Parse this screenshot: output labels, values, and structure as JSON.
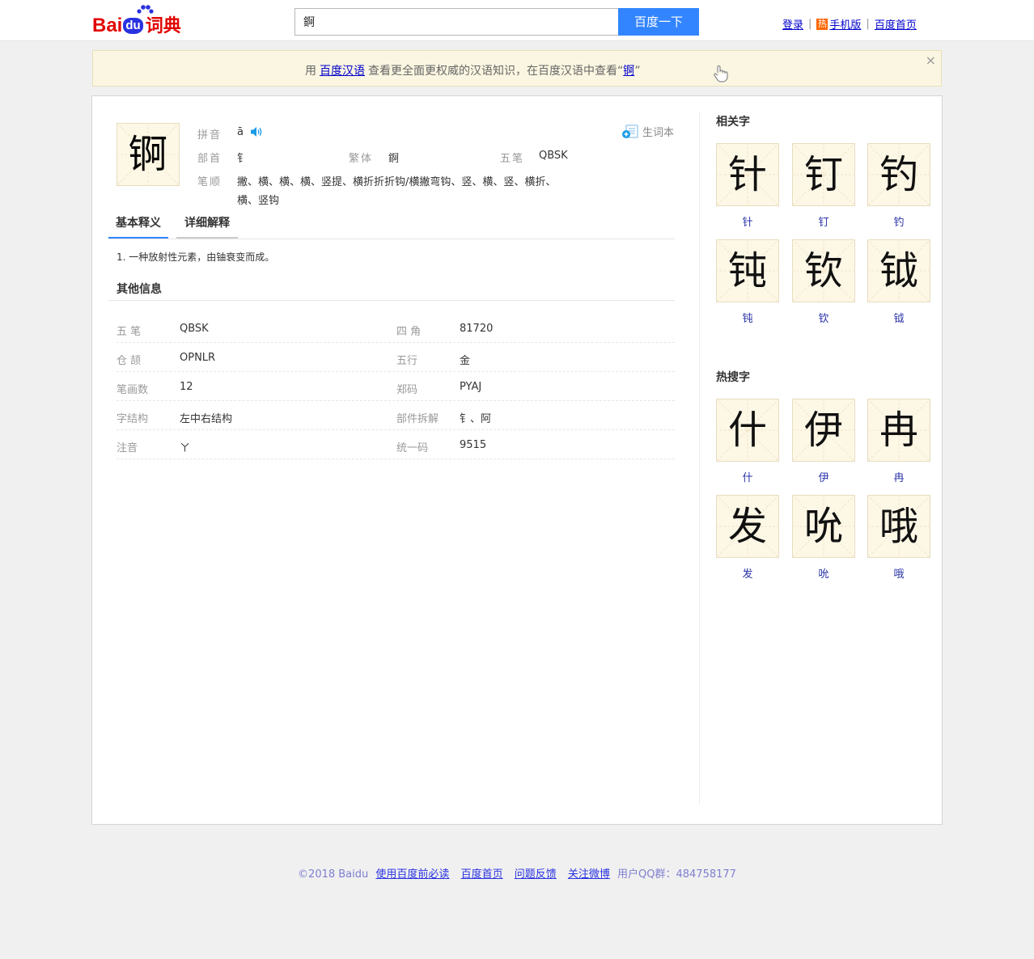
{
  "header": {
    "logo_text_bai": "Bai",
    "logo_text_du": "du",
    "logo_text_cidian": "词典",
    "search_value": "錒",
    "search_button": "百度一下",
    "links": [
      "登录",
      "手机版",
      "百度首页"
    ],
    "hot_badge": "热"
  },
  "banner": {
    "prefix": "用",
    "link1": "百度汉语",
    "middle": "查看更全面更权威的汉语知识，在百度汉语中查看“",
    "link2": "锕",
    "suffix": "”",
    "close": "×"
  },
  "entry": {
    "character": "锕",
    "pinyin_label": "拼音",
    "pinyin": "ā",
    "radical_label": "部首",
    "radical": "钅",
    "traditional_label": "繁体",
    "traditional": "錒",
    "wubi_label": "五笔",
    "wubi": "QBSK",
    "strokes_label": "笔顺",
    "strokes_line1": "撇、横、横、横、竖提、横折折折钩/横撇弯钩、竖、横、竖、横折、",
    "strokes_line2": "横、竖钩",
    "vocab_label": "生词本"
  },
  "tabs": [
    "基本释义",
    "详细解释"
  ],
  "definition": "1. 一种放射性元素，由铀衰变而成。",
  "other_info": {
    "title": "其他信息",
    "rows": [
      {
        "l1": "五 笔",
        "v1": "QBSK",
        "l2": "四 角",
        "v2": "81720"
      },
      {
        "l1": "仓 颉",
        "v1": "OPNLR",
        "l2": "五行",
        "v2": "金"
      },
      {
        "l1": "笔画数",
        "v1": "12",
        "l2": "郑码",
        "v2": "PYAJ"
      },
      {
        "l1": "字结构",
        "v1": "左中右结构",
        "l2": "部件拆解",
        "v2": "钅、阿"
      },
      {
        "l1": "注音",
        "v1": "ㄚ",
        "l2": "统一码",
        "v2": "9515"
      }
    ]
  },
  "sidebar": {
    "related_title": "相关字",
    "related": [
      "针",
      "钉",
      "钓",
      "钝",
      "钦",
      "钺"
    ],
    "hot_title": "热搜字",
    "hot": [
      "什",
      "伊",
      "冉",
      "发",
      "吮",
      "哦"
    ]
  },
  "footer": {
    "copyright": "©2018 Baidu",
    "links": [
      "使用百度前必读",
      "百度首页",
      "问题反馈",
      "关注微博"
    ],
    "qq": "用户QQ群：484758177"
  },
  "colors": {
    "accent": "#3385ff",
    "logo_red": "#e10602",
    "logo_blue": "#2932e1",
    "grid_bg": "#fdf7e6"
  }
}
